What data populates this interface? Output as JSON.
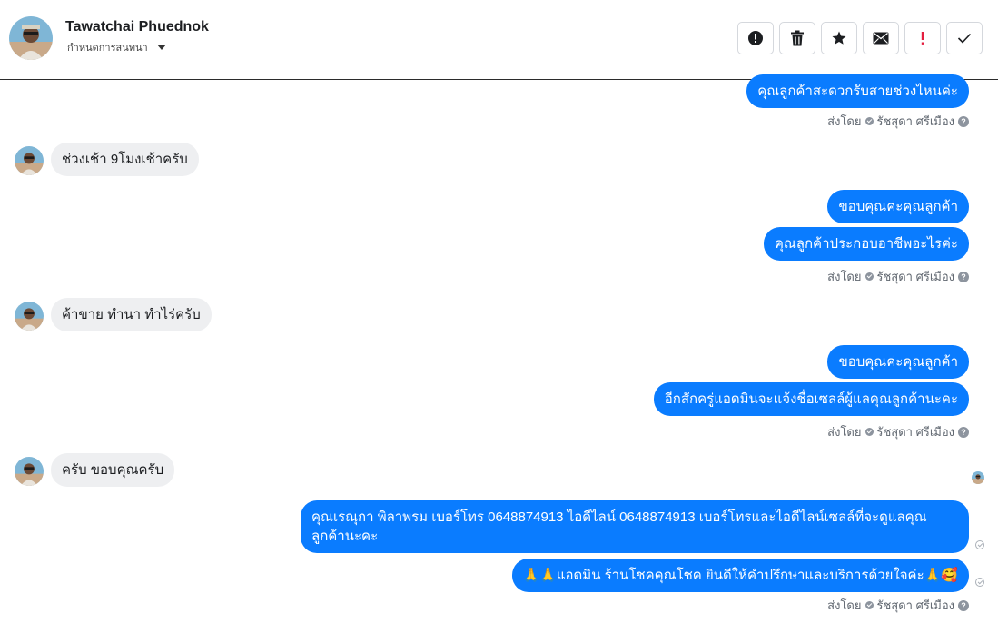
{
  "contact": {
    "name": "Tawatchai Phuednok",
    "subtitle": "กำหนดการสนทนา"
  },
  "actions": [
    {
      "icon": "alert-circle-icon",
      "label": "Spam"
    },
    {
      "icon": "trash-icon",
      "label": "Delete"
    },
    {
      "icon": "star-icon",
      "label": "Star"
    },
    {
      "icon": "envelope-icon",
      "label": "Mark unread"
    },
    {
      "icon": "exclamation-icon",
      "label": "Follow up"
    },
    {
      "icon": "check-icon",
      "label": "Done"
    }
  ],
  "messages": [
    {
      "dir": "out",
      "text": "คุณลูกค้าสะดวกรับสายช่วงไหนค่ะ"
    },
    {
      "dir": "sent_by",
      "text": "ส่งโดย",
      "agent": "รัชสุดา ศรีเมือง"
    },
    {
      "dir": "in",
      "text": "ช่วงเช้า 9โมงเช้าครับ"
    },
    {
      "dir": "out",
      "text": "ขอบคุณค่ะคุณลูกค้า"
    },
    {
      "dir": "out",
      "text": "คุณลูกค้าประกอบอาชีพอะไรค่ะ"
    },
    {
      "dir": "sent_by",
      "text": "ส่งโดย",
      "agent": "รัชสุดา ศรีเมือง"
    },
    {
      "dir": "in",
      "text": "ค้าขาย ทำนา ทำไร่ครับ"
    },
    {
      "dir": "out",
      "text": "ขอบคุณค่ะคุณลูกค้า"
    },
    {
      "dir": "out",
      "text": "อีกสักครู่แอดมินจะแจ้งชื่อเซลล์ผู้แลคุณลูกค้านะคะ"
    },
    {
      "dir": "sent_by",
      "text": "ส่งโดย",
      "agent": "รัชสุดา ศรีเมือง"
    },
    {
      "dir": "in",
      "text": "ครับ ขอบคุณครับ"
    },
    {
      "dir": "out",
      "text": "คุณเรณุกา พิลาพรม        เบอร์โทร 0648874913  ไอดีไลน์ 0648874913   เบอร์โทรและไอดีไลน์เซลล์ที่จะดูแลคุณลูกค้านะคะ"
    },
    {
      "dir": "out",
      "text": "🙏🙏แอดมิน ร้านโชคคุณโชค ยินดีให้คำปรึกษาและบริการด้วยใจค่ะ🙏🥰"
    },
    {
      "dir": "sent_by",
      "text": "ส่งโดย",
      "agent": "รัชสุดา ศรีเมือง"
    }
  ],
  "colors": {
    "outgoing_bubble": "#0a7cff",
    "incoming_bubble": "#eeeff1",
    "exclamation_red": "#e41e3f"
  }
}
